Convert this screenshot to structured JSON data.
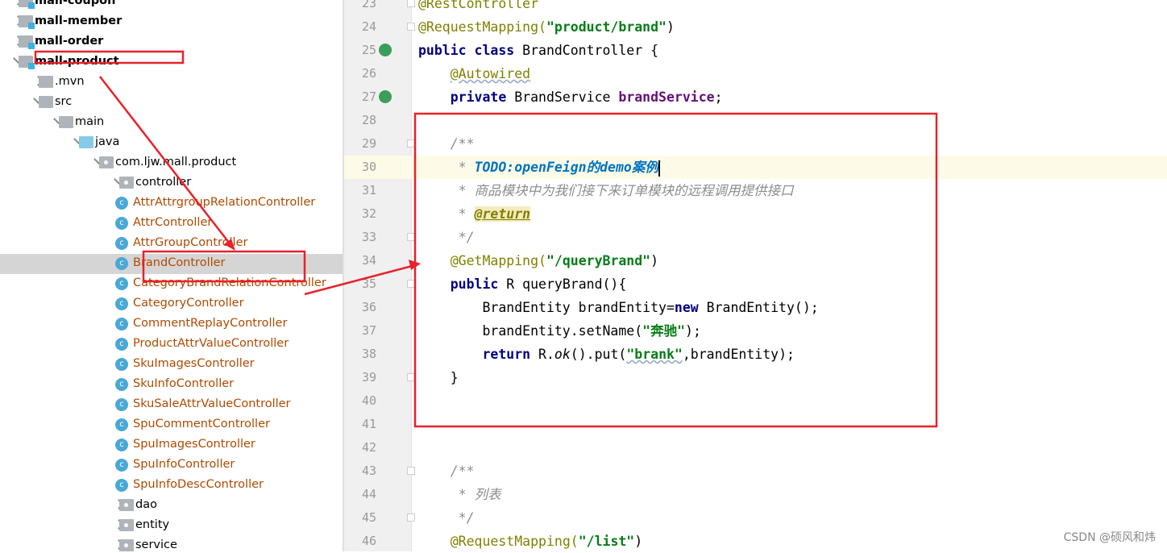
{
  "tree": [
    {
      "label": "mall-coupon",
      "depth": 0,
      "chev": "r",
      "icon": "module",
      "bold": true
    },
    {
      "label": "mall-member",
      "depth": 0,
      "chev": "r",
      "icon": "module",
      "bold": true
    },
    {
      "label": "mall-order",
      "depth": 0,
      "chev": "r",
      "icon": "module",
      "bold": true
    },
    {
      "label": "mall-product",
      "depth": 0,
      "chev": "d",
      "icon": "module",
      "bold": true
    },
    {
      "label": ".mvn",
      "depth": 1,
      "chev": "r",
      "icon": "folder"
    },
    {
      "label": "src",
      "depth": 1,
      "chev": "d",
      "icon": "folder"
    },
    {
      "label": "main",
      "depth": 2,
      "chev": "d",
      "icon": "folder"
    },
    {
      "label": "java",
      "depth": 3,
      "chev": "d",
      "icon": "source"
    },
    {
      "label": "com.ljw.mall.product",
      "depth": 4,
      "chev": "d",
      "icon": "package"
    },
    {
      "label": "controller",
      "depth": 5,
      "chev": "d",
      "icon": "package"
    },
    {
      "label": "AttrAttrgroupRelationController",
      "depth": 6,
      "icon": "class"
    },
    {
      "label": "AttrController",
      "depth": 6,
      "icon": "class"
    },
    {
      "label": "AttrGroupController",
      "depth": 6,
      "icon": "class"
    },
    {
      "label": "BrandController",
      "depth": 6,
      "icon": "class",
      "selected": true
    },
    {
      "label": "CategoryBrandRelationController",
      "depth": 6,
      "icon": "class"
    },
    {
      "label": "CategoryController",
      "depth": 6,
      "icon": "class"
    },
    {
      "label": "CommentReplayController",
      "depth": 6,
      "icon": "class"
    },
    {
      "label": "ProductAttrValueController",
      "depth": 6,
      "icon": "class"
    },
    {
      "label": "SkuImagesController",
      "depth": 6,
      "icon": "class"
    },
    {
      "label": "SkuInfoController",
      "depth": 6,
      "icon": "class"
    },
    {
      "label": "SkuSaleAttrValueController",
      "depth": 6,
      "icon": "class"
    },
    {
      "label": "SpuCommentController",
      "depth": 6,
      "icon": "class"
    },
    {
      "label": "SpuImagesController",
      "depth": 6,
      "icon": "class"
    },
    {
      "label": "SpuInfoController",
      "depth": 6,
      "icon": "class"
    },
    {
      "label": "SpuInfoDescController",
      "depth": 6,
      "icon": "class"
    },
    {
      "label": "dao",
      "depth": 5,
      "chev": "r",
      "icon": "package"
    },
    {
      "label": "entity",
      "depth": 5,
      "chev": "r",
      "icon": "package"
    },
    {
      "label": "service",
      "depth": 5,
      "chev": "r",
      "icon": "package"
    }
  ],
  "editor": {
    "current_line": 30,
    "lines": [
      {
        "n": "23",
        "t": [
          [
            "@RestController",
            "ann"
          ]
        ]
      },
      {
        "n": "24",
        "t": [
          [
            "@RequestMapping(",
            "ann"
          ],
          [
            "\"product/brand\"",
            "str"
          ],
          [
            ")",
            ""
          ]
        ]
      },
      {
        "n": "25",
        "t": [
          [
            "public class ",
            "kw"
          ],
          [
            "BrandController {",
            ""
          ]
        ]
      },
      {
        "n": "26",
        "t": [
          [
            "    ",
            ""
          ],
          [
            "@Autowired",
            "ann wavy"
          ]
        ]
      },
      {
        "n": "27",
        "t": [
          [
            "    ",
            ""
          ],
          [
            "private ",
            "kw"
          ],
          [
            "BrandService ",
            ""
          ],
          [
            "brandService",
            "fld"
          ],
          [
            ";",
            ""
          ]
        ]
      },
      {
        "n": "28",
        "t": []
      },
      {
        "n": "29",
        "t": [
          [
            "    /**",
            "cmt"
          ]
        ]
      },
      {
        "n": "30",
        "t": [
          [
            "     * ",
            "cmt"
          ],
          [
            "TODO:openFeign的demo案例",
            "todo"
          ]
        ]
      },
      {
        "n": "31",
        "t": [
          [
            "     * 商品模块中为我们接下来订单模块的远程调用提供接口",
            "cmt"
          ]
        ]
      },
      {
        "n": "32",
        "t": [
          [
            "     * ",
            "cmt"
          ],
          [
            "@return",
            "tag"
          ]
        ]
      },
      {
        "n": "33",
        "t": [
          [
            "     */",
            "cmt"
          ]
        ]
      },
      {
        "n": "34",
        "t": [
          [
            "    ",
            ""
          ],
          [
            "@GetMapping(",
            "ann"
          ],
          [
            "\"/queryBrand\"",
            "str"
          ],
          [
            ")",
            ""
          ]
        ]
      },
      {
        "n": "35",
        "t": [
          [
            "    ",
            ""
          ],
          [
            "public ",
            "kw"
          ],
          [
            "R queryBrand(){",
            ""
          ]
        ]
      },
      {
        "n": "36",
        "t": [
          [
            "        BrandEntity brandEntity=",
            ""
          ],
          [
            "new ",
            "kw"
          ],
          [
            "BrandEntity();",
            ""
          ]
        ]
      },
      {
        "n": "37",
        "t": [
          [
            "        brandEntity.setName(",
            ""
          ],
          [
            "\"奔驰\"",
            "str"
          ],
          [
            ");",
            ""
          ]
        ]
      },
      {
        "n": "38",
        "t": [
          [
            "        ",
            ""
          ],
          [
            "return ",
            "kw"
          ],
          [
            "R.",
            ""
          ],
          [
            "ok",
            "it"
          ],
          [
            "().put(",
            ""
          ],
          [
            "\"brank\"",
            "str wavy"
          ],
          [
            ",brandEntity);",
            ""
          ]
        ]
      },
      {
        "n": "39",
        "t": [
          [
            "    }",
            ""
          ]
        ]
      },
      {
        "n": "40",
        "t": []
      },
      {
        "n": "41",
        "t": []
      },
      {
        "n": "42",
        "t": []
      },
      {
        "n": "43",
        "t": [
          [
            "    /**",
            "cmt"
          ]
        ]
      },
      {
        "n": "44",
        "t": [
          [
            "     * 列表",
            "cmt"
          ]
        ]
      },
      {
        "n": "45",
        "t": [
          [
            "     */",
            "cmt"
          ]
        ]
      },
      {
        "n": "46",
        "t": [
          [
            "    ",
            ""
          ],
          [
            "@RequestMapping(",
            "ann"
          ],
          [
            "\"/list\"",
            "str"
          ],
          [
            ")",
            ""
          ]
        ]
      }
    ]
  },
  "watermark": "CSDN @硕风和炜",
  "colors": {
    "annotation_red": "#e8212b",
    "selection": "#d5d5d5",
    "current_line": "#fdfbe8"
  }
}
